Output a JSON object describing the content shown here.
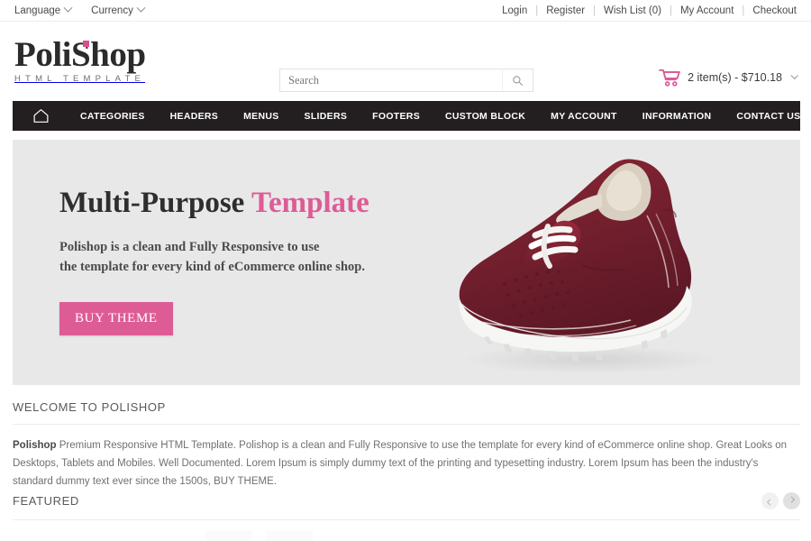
{
  "topbar": {
    "language": {
      "label": "Language",
      "icon": "chevron-down-icon"
    },
    "currency": {
      "label": "Currency",
      "icon": "chevron-down-icon"
    },
    "links": [
      {
        "label": "Login"
      },
      {
        "label": "Register"
      },
      {
        "label": "Wish List (0)"
      },
      {
        "label": "My Account"
      },
      {
        "label": "Checkout"
      }
    ],
    "separator": "|"
  },
  "header": {
    "logo": {
      "main": "PoliShop",
      "sub": "HTML TEMPLATE",
      "dot_color": "#d94f8c"
    },
    "search": {
      "placeholder": "Search",
      "value": "",
      "icon": "search-icon"
    },
    "cart": {
      "icon": "shopping-cart-icon",
      "text": "2 item(s) - $710.18",
      "items": 2,
      "total": "$710.18",
      "color": "#dd5c96"
    }
  },
  "nav": {
    "home_icon": "home-icon",
    "items": [
      {
        "label": "CATEGORIES"
      },
      {
        "label": "HEADERS"
      },
      {
        "label": "MENUS"
      },
      {
        "label": "SLIDERS"
      },
      {
        "label": "FOOTERS"
      },
      {
        "label": "CUSTOM BLOCK"
      },
      {
        "label": "MY ACCOUNT"
      },
      {
        "label": "INFORMATION"
      },
      {
        "label": "CONTACT US"
      }
    ],
    "bg_color": "#231f20"
  },
  "hero": {
    "title_plain": "Multi-Purpose ",
    "title_accent": "Template",
    "subtitle_line1": "Polishop is a clean and Fully Responsive to use",
    "subtitle_line2": "the template for every kind of eCommerce online shop.",
    "button_label": "BUY THEME",
    "accent_color": "#dd5c96",
    "bg_color": "#e8e8e8",
    "image": "burgundy-suede-sneaker"
  },
  "welcome": {
    "title": "WELCOME TO POLISHOP",
    "body_bold": "Polishop",
    "body": " Premium Responsive HTML Template. Polishop is a clean and Fully Responsive to use the template for every kind of eCommerce online shop. Great Looks on Desktops, Tablets and Mobiles. Well Documented. Lorem Ipsum is simply dummy text of the printing and typesetting industry. Lorem Ipsum has been the industry's standard dummy text ever since the 1500s, BUY THEME."
  },
  "featured": {
    "title": "FEATURED",
    "prev_icon": "chevron-left-icon",
    "next_icon": "chevron-right-icon"
  }
}
